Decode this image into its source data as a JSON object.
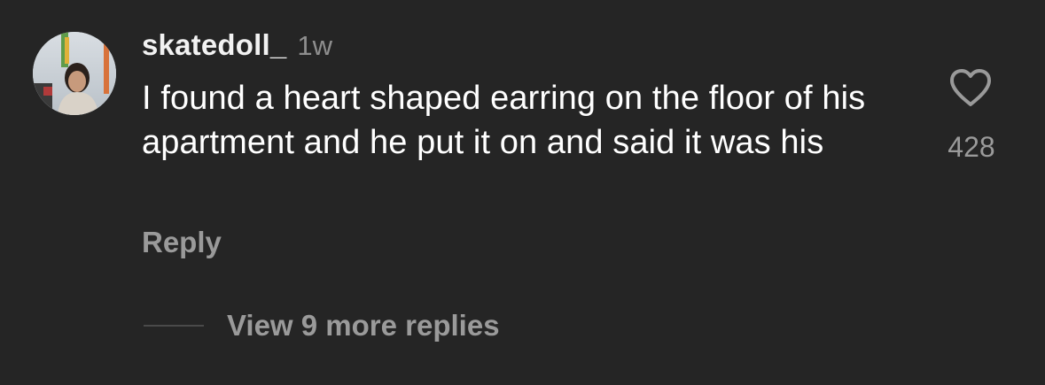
{
  "comment": {
    "username": "skatedoll_",
    "timestamp": "1w",
    "text": "I found a heart shaped earring on the floor of his apartment and he put it on and said it was his",
    "reply_label": "Reply",
    "likes": "428",
    "view_replies_label": "View 9 more replies",
    "like_icon": "heart-outline-icon"
  }
}
